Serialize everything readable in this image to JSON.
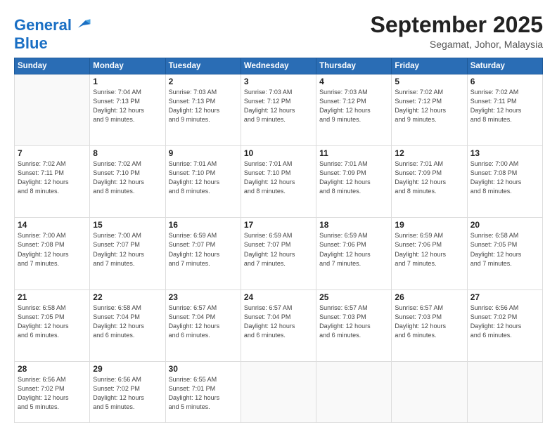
{
  "logo": {
    "line1": "General",
    "line2": "Blue"
  },
  "title": "September 2025",
  "location": "Segamat, Johor, Malaysia",
  "days_of_week": [
    "Sunday",
    "Monday",
    "Tuesday",
    "Wednesday",
    "Thursday",
    "Friday",
    "Saturday"
  ],
  "weeks": [
    [
      {
        "day": "",
        "info": ""
      },
      {
        "day": "1",
        "info": "Sunrise: 7:04 AM\nSunset: 7:13 PM\nDaylight: 12 hours\nand 9 minutes."
      },
      {
        "day": "2",
        "info": "Sunrise: 7:03 AM\nSunset: 7:13 PM\nDaylight: 12 hours\nand 9 minutes."
      },
      {
        "day": "3",
        "info": "Sunrise: 7:03 AM\nSunset: 7:12 PM\nDaylight: 12 hours\nand 9 minutes."
      },
      {
        "day": "4",
        "info": "Sunrise: 7:03 AM\nSunset: 7:12 PM\nDaylight: 12 hours\nand 9 minutes."
      },
      {
        "day": "5",
        "info": "Sunrise: 7:02 AM\nSunset: 7:12 PM\nDaylight: 12 hours\nand 9 minutes."
      },
      {
        "day": "6",
        "info": "Sunrise: 7:02 AM\nSunset: 7:11 PM\nDaylight: 12 hours\nand 8 minutes."
      }
    ],
    [
      {
        "day": "7",
        "info": "Sunrise: 7:02 AM\nSunset: 7:11 PM\nDaylight: 12 hours\nand 8 minutes."
      },
      {
        "day": "8",
        "info": "Sunrise: 7:02 AM\nSunset: 7:10 PM\nDaylight: 12 hours\nand 8 minutes."
      },
      {
        "day": "9",
        "info": "Sunrise: 7:01 AM\nSunset: 7:10 PM\nDaylight: 12 hours\nand 8 minutes."
      },
      {
        "day": "10",
        "info": "Sunrise: 7:01 AM\nSunset: 7:10 PM\nDaylight: 12 hours\nand 8 minutes."
      },
      {
        "day": "11",
        "info": "Sunrise: 7:01 AM\nSunset: 7:09 PM\nDaylight: 12 hours\nand 8 minutes."
      },
      {
        "day": "12",
        "info": "Sunrise: 7:01 AM\nSunset: 7:09 PM\nDaylight: 12 hours\nand 8 minutes."
      },
      {
        "day": "13",
        "info": "Sunrise: 7:00 AM\nSunset: 7:08 PM\nDaylight: 12 hours\nand 8 minutes."
      }
    ],
    [
      {
        "day": "14",
        "info": "Sunrise: 7:00 AM\nSunset: 7:08 PM\nDaylight: 12 hours\nand 7 minutes."
      },
      {
        "day": "15",
        "info": "Sunrise: 7:00 AM\nSunset: 7:07 PM\nDaylight: 12 hours\nand 7 minutes."
      },
      {
        "day": "16",
        "info": "Sunrise: 6:59 AM\nSunset: 7:07 PM\nDaylight: 12 hours\nand 7 minutes."
      },
      {
        "day": "17",
        "info": "Sunrise: 6:59 AM\nSunset: 7:07 PM\nDaylight: 12 hours\nand 7 minutes."
      },
      {
        "day": "18",
        "info": "Sunrise: 6:59 AM\nSunset: 7:06 PM\nDaylight: 12 hours\nand 7 minutes."
      },
      {
        "day": "19",
        "info": "Sunrise: 6:59 AM\nSunset: 7:06 PM\nDaylight: 12 hours\nand 7 minutes."
      },
      {
        "day": "20",
        "info": "Sunrise: 6:58 AM\nSunset: 7:05 PM\nDaylight: 12 hours\nand 7 minutes."
      }
    ],
    [
      {
        "day": "21",
        "info": "Sunrise: 6:58 AM\nSunset: 7:05 PM\nDaylight: 12 hours\nand 6 minutes."
      },
      {
        "day": "22",
        "info": "Sunrise: 6:58 AM\nSunset: 7:04 PM\nDaylight: 12 hours\nand 6 minutes."
      },
      {
        "day": "23",
        "info": "Sunrise: 6:57 AM\nSunset: 7:04 PM\nDaylight: 12 hours\nand 6 minutes."
      },
      {
        "day": "24",
        "info": "Sunrise: 6:57 AM\nSunset: 7:04 PM\nDaylight: 12 hours\nand 6 minutes."
      },
      {
        "day": "25",
        "info": "Sunrise: 6:57 AM\nSunset: 7:03 PM\nDaylight: 12 hours\nand 6 minutes."
      },
      {
        "day": "26",
        "info": "Sunrise: 6:57 AM\nSunset: 7:03 PM\nDaylight: 12 hours\nand 6 minutes."
      },
      {
        "day": "27",
        "info": "Sunrise: 6:56 AM\nSunset: 7:02 PM\nDaylight: 12 hours\nand 6 minutes."
      }
    ],
    [
      {
        "day": "28",
        "info": "Sunrise: 6:56 AM\nSunset: 7:02 PM\nDaylight: 12 hours\nand 5 minutes."
      },
      {
        "day": "29",
        "info": "Sunrise: 6:56 AM\nSunset: 7:02 PM\nDaylight: 12 hours\nand 5 minutes."
      },
      {
        "day": "30",
        "info": "Sunrise: 6:55 AM\nSunset: 7:01 PM\nDaylight: 12 hours\nand 5 minutes."
      },
      {
        "day": "",
        "info": ""
      },
      {
        "day": "",
        "info": ""
      },
      {
        "day": "",
        "info": ""
      },
      {
        "day": "",
        "info": ""
      }
    ]
  ]
}
